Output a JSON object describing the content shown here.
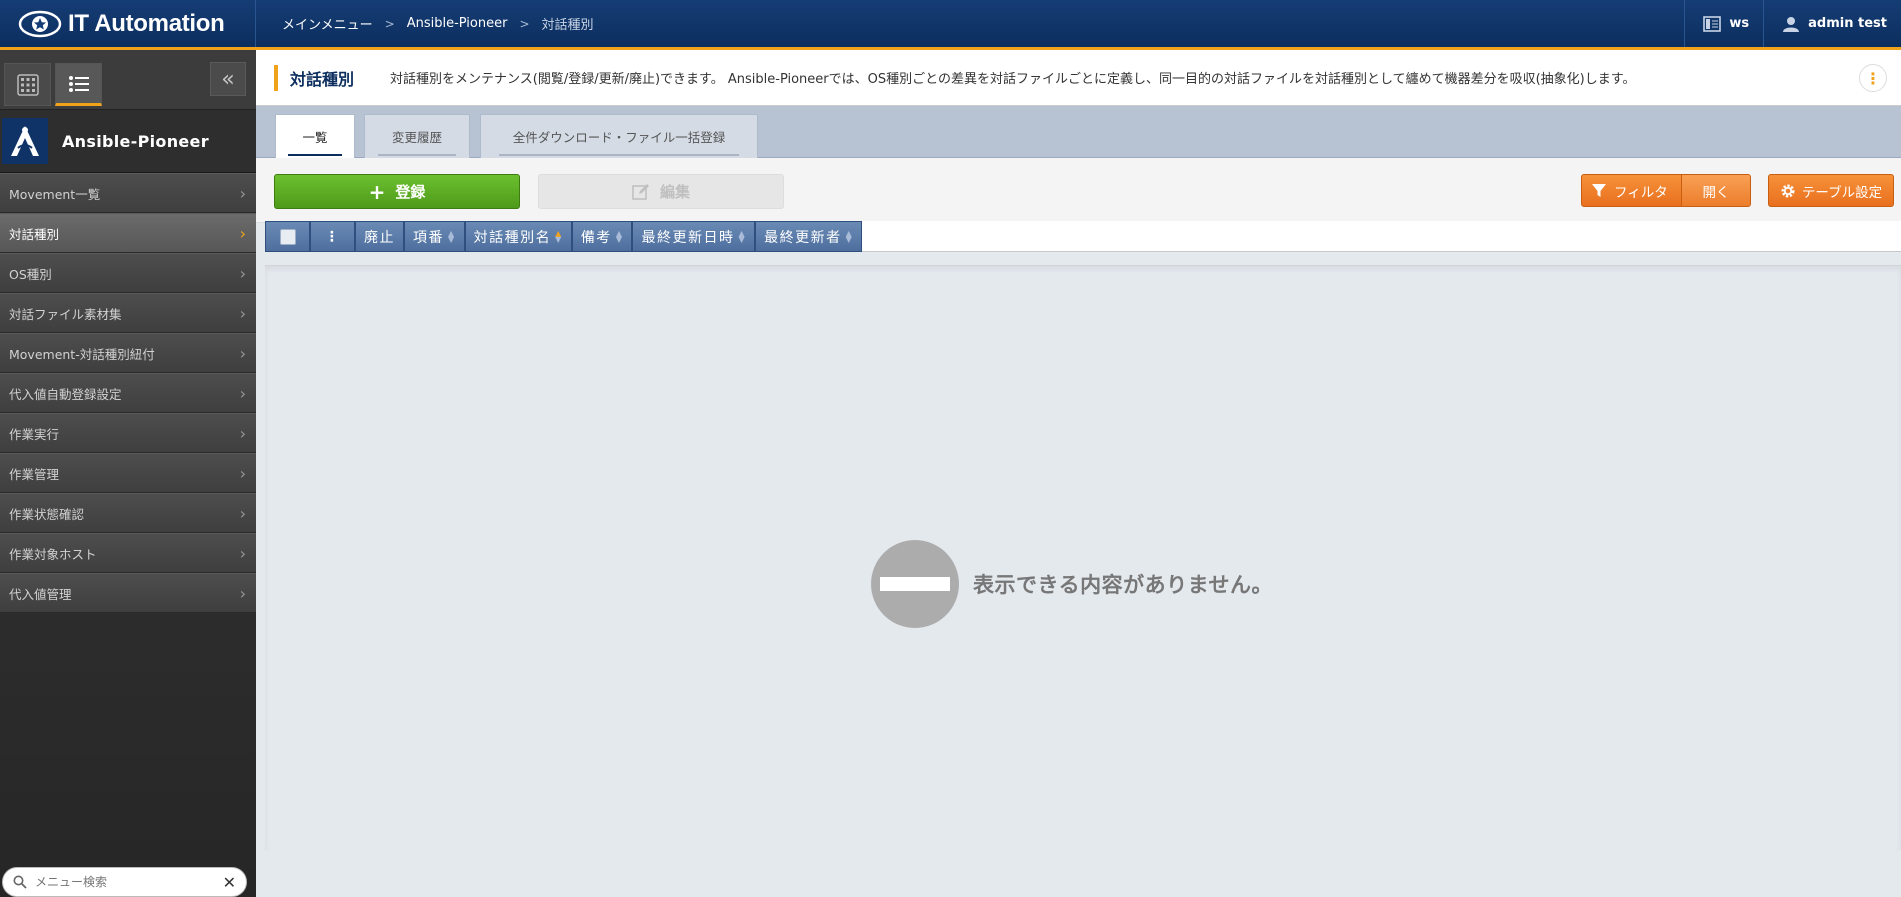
{
  "header": {
    "app_name": "IT Automation",
    "breadcrumb": [
      "メインメニュー",
      "Ansible-Pioneer",
      "対話種別"
    ],
    "workspace": "ws",
    "user": "admin test"
  },
  "sidebar": {
    "menu_group": "Ansible-Pioneer",
    "items": [
      {
        "label": "Movement一覧"
      },
      {
        "label": "対話種別"
      },
      {
        "label": "OS種別"
      },
      {
        "label": "対話ファイル素材集"
      },
      {
        "label": "Movement-対話種別紐付"
      },
      {
        "label": "代入値自動登録設定"
      },
      {
        "label": "作業実行"
      },
      {
        "label": "作業管理"
      },
      {
        "label": "作業状態確認"
      },
      {
        "label": "作業対象ホスト"
      },
      {
        "label": "代入値管理"
      }
    ],
    "active_index": 1,
    "search_placeholder": "メニュー検索"
  },
  "page": {
    "title": "対話種別",
    "description": "対話種別をメンテナンス(閲覧/登録/更新/廃止)できます。 Ansible-Pioneerでは、OS種別ごとの差異を対話ファイルごとに定義し、同一目的の対話ファイルを対話種別として纏めて機器差分を吸収(抽象化)します。"
  },
  "tabs": [
    {
      "label": "一覧",
      "active": true
    },
    {
      "label": "変更履歴",
      "active": false
    },
    {
      "label": "全件ダウンロード・ファイル一括登録",
      "active": false
    }
  ],
  "toolbar": {
    "register": "登録",
    "edit": "編集",
    "filter": "フィルタ",
    "filter_open": "開く",
    "table_settings": "テーブル設定"
  },
  "table": {
    "columns": [
      "廃止",
      "項番",
      "対話種別名",
      "備考",
      "最終更新日時",
      "最終更新者"
    ],
    "empty_message": "表示できる内容がありません。"
  },
  "colors": {
    "header_bg": "#0c2e5e",
    "accent": "#f0a21b",
    "register_green": "#5aab22",
    "orange_button": "#ee7b25"
  }
}
